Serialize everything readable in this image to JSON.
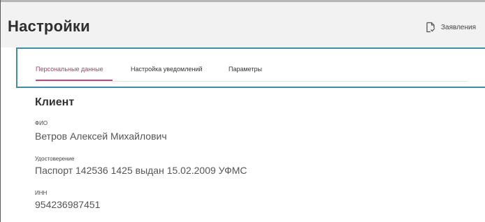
{
  "page": {
    "title": "Настройки"
  },
  "header": {
    "requests_label": "Заявления",
    "requests_icon": "document-check-icon"
  },
  "tabs": [
    {
      "label": "Персональные данные",
      "active": true
    },
    {
      "label": "Настройка уведомлений",
      "active": false
    },
    {
      "label": "Параметры",
      "active": false
    }
  ],
  "client": {
    "section_title": "Клиент",
    "fields": [
      {
        "label": "ФИО",
        "value": "Ветров Алексей Михайлович"
      },
      {
        "label": "Удостоверение",
        "value": "Паспорт 142536 1425 выдан 15.02.2009 УФМС"
      },
      {
        "label": "ИНН",
        "value": "954236987451"
      }
    ]
  },
  "colors": {
    "accent": "#a3406a",
    "frame_border": "#3c8ea0",
    "header_bg": "#f2f2f2"
  }
}
